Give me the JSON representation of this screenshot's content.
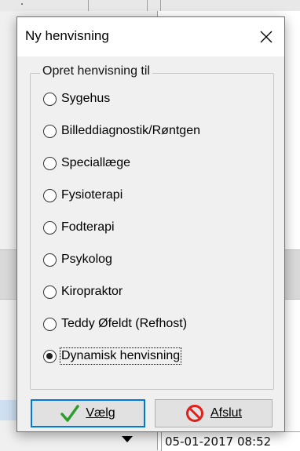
{
  "dialog": {
    "title": "Ny henvisning",
    "group_label": "Opret henvisning til",
    "options": [
      {
        "label": "Sygehus",
        "checked": false
      },
      {
        "label": "Billeddiagnostik/Røntgen",
        "checked": false
      },
      {
        "label": "Speciallæge",
        "checked": false
      },
      {
        "label": "Fysioterapi",
        "checked": false
      },
      {
        "label": "Fodterapi",
        "checked": false
      },
      {
        "label": "Psykolog",
        "checked": false
      },
      {
        "label": "Kiropraktor",
        "checked": false
      },
      {
        "label": "Teddy Øfeldt (Refhost)",
        "checked": false
      },
      {
        "label": "Dynamisk henvisning",
        "checked": true
      }
    ],
    "ok_button": {
      "label": "Vælg",
      "icon": "checkmark-icon",
      "color": "#2e9d2e"
    },
    "cancel_button": {
      "label": "Afslut",
      "icon": "no-entry-icon",
      "color": "#e0201b"
    }
  },
  "background": {
    "bottom_right_cell": "05-01-2017 08:52"
  },
  "colors": {
    "focus_border": "#0078d7",
    "dialog_bg": "#f0f0f0"
  }
}
